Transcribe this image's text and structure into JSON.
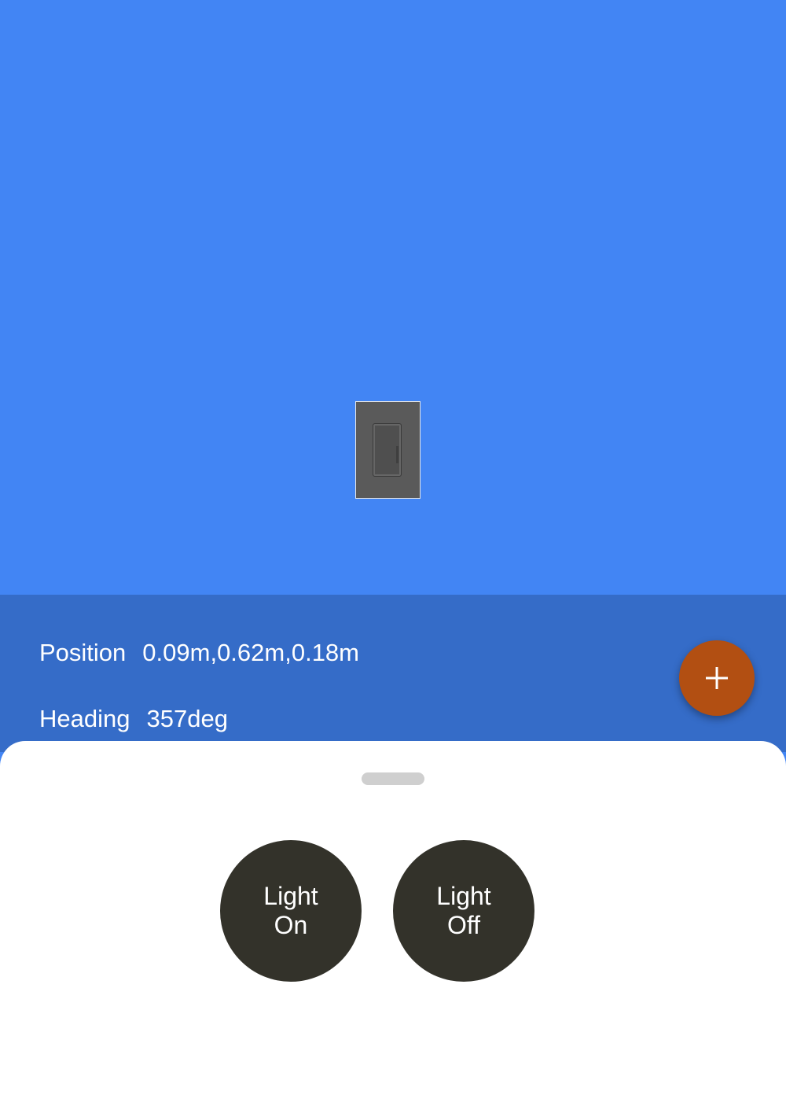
{
  "info": {
    "position_label": "Position",
    "position_value": "0.09m,0.62m,0.18m",
    "heading_label": "Heading",
    "heading_value": "357deg"
  },
  "fab": {
    "icon": "plus-icon"
  },
  "sheet": {
    "buttons": [
      {
        "line1": "Light",
        "line2": "On"
      },
      {
        "line1": "Light",
        "line2": "Off"
      }
    ]
  },
  "colors": {
    "camera_background": "#4285f4",
    "info_panel": "#356cc8",
    "fab": "#b24f12",
    "action_button": "#33322a",
    "sheet": "#ffffff"
  },
  "scene": {
    "object": "light-switch"
  }
}
